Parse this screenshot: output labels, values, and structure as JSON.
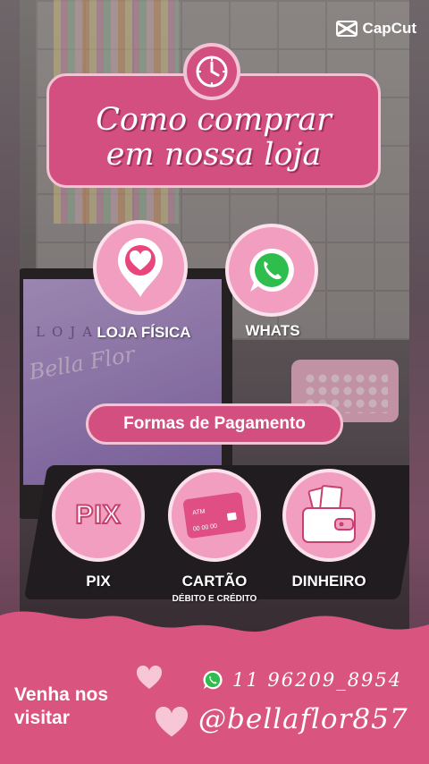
{
  "watermark": {
    "brand": "CapCut",
    "icon": "capcut-logo-icon"
  },
  "banner": {
    "title_line1": "Como comprar",
    "title_line2": "em nossa loja",
    "icon": "clock-icon"
  },
  "contact_options": [
    {
      "label": "LOJA FÍSICA",
      "icon": "location-heart-icon"
    },
    {
      "label": "WHATS",
      "icon": "whatsapp-icon"
    }
  ],
  "payment": {
    "heading": "Formas de Pagamento",
    "methods": [
      {
        "label": "PIX",
        "icon_text": "PIX",
        "sublabel": ""
      },
      {
        "label": "CARTÃO",
        "icon": "credit-card-icon",
        "card_text": "ATM",
        "card_number": "00 00 00",
        "sublabel": "DÉBITO E CRÉDITO"
      },
      {
        "label": "DINHEIRO",
        "icon": "wallet-cash-icon",
        "sublabel": ""
      }
    ]
  },
  "footer": {
    "cta": "Venha nos visitar",
    "phone": "11 96209_8954",
    "handle": "@bellaflor857"
  },
  "background": {
    "screen_line1": "LOJA",
    "screen_line2": "Bella Flor"
  },
  "colors": {
    "primary": "#d24f7f",
    "light_pink": "#f29ec0",
    "border": "#f4c3d3",
    "wave": "#d9547f"
  }
}
